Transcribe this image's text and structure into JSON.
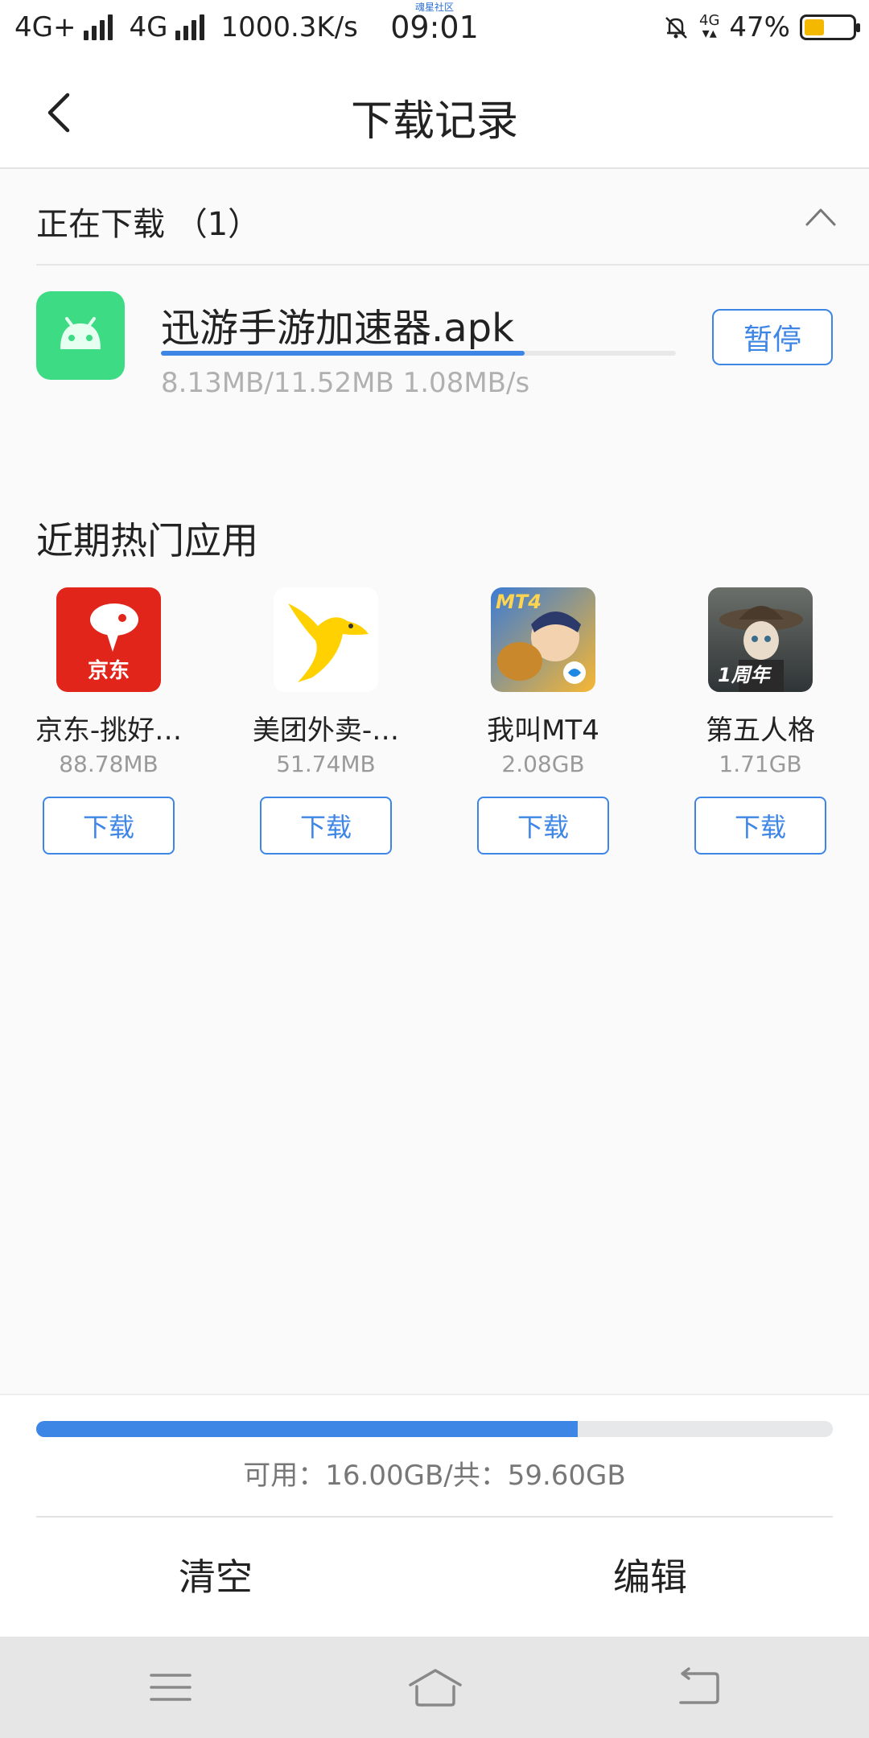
{
  "status_bar": {
    "network_left": "4G+",
    "network_right": "4G",
    "speed": "1000.3K/s",
    "time": "09:01",
    "watermark": "魂星社区",
    "network_small": "4G",
    "battery": "47%",
    "battery_level": 0.47
  },
  "header": {
    "title": "下载记录"
  },
  "downloading": {
    "section_title": "正在下载 （1）",
    "item": {
      "name": "迅游手游加速器.apk",
      "progress_text": "8.13MB/11.52MB  1.08MB/s",
      "progress": 0.706,
      "button": "暂停"
    }
  },
  "hot_apps": {
    "title": "近期热门应用",
    "items": [
      {
        "name": "京东-挑好…",
        "size": "88.78MB",
        "button": "下载",
        "icon_label": "京东"
      },
      {
        "name": "美团外卖-…",
        "size": "51.74MB",
        "button": "下载"
      },
      {
        "name": "我叫MT4",
        "size": "2.08GB",
        "button": "下载",
        "icon_label": "MT4"
      },
      {
        "name": "第五人格",
        "size": "1.71GB",
        "button": "下载",
        "icon_label": "1周年"
      }
    ]
  },
  "storage": {
    "text": "可用：16.00GB/共：59.60GB",
    "used_fraction": 0.68
  },
  "actions": {
    "clear": "清空",
    "edit": "编辑"
  },
  "colors": {
    "accent": "#3e86e6",
    "android_green": "#3ddc84",
    "battery": "#f5b800"
  },
  "nav_icons": [
    "menu-icon",
    "home-icon",
    "back-icon"
  ]
}
